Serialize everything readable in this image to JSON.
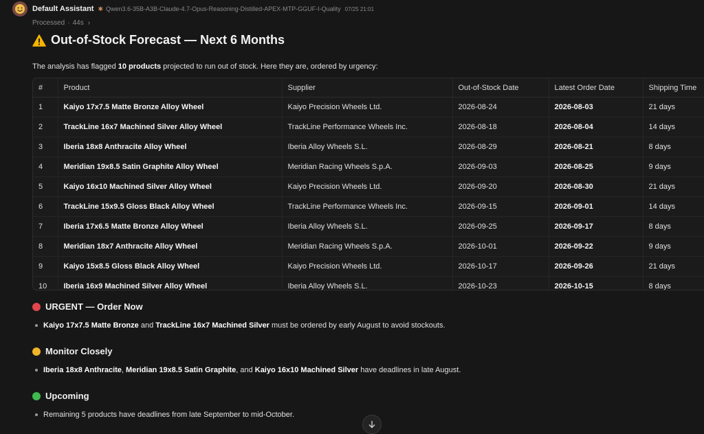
{
  "header": {
    "assistant_name": "Default Assistant",
    "model_name": "Qwen3.6-35B-A3B-Claude-4.7-Opus-Reasoning-Distilled-APEX-MTP-GGUF-I-Quality",
    "timestamp": "07/25 21:01",
    "avatar_icon": "smiley-avatar-icon"
  },
  "status": {
    "processed_label": "Processed",
    "duration": "44s"
  },
  "title": {
    "icon": "warning-icon",
    "text": "Out-of-Stock Forecast — Next 6 Months"
  },
  "intro": {
    "before": "The analysis has flagged ",
    "bold": "10 products",
    "after": " projected to run out of stock. Here they are, ordered by urgency:"
  },
  "table": {
    "headers": [
      "#",
      "Product",
      "Supplier",
      "Out-of-Stock Date",
      "Latest Order Date",
      "Shipping Time"
    ],
    "rows": [
      [
        "1",
        "Kaiyo 17x7.5 Matte Bronze Alloy Wheel",
        "Kaiyo Precision Wheels Ltd.",
        "2026-08-24",
        "2026-08-03",
        "21 days"
      ],
      [
        "2",
        "TrackLine 16x7 Machined Silver Alloy Wheel",
        "TrackLine Performance Wheels Inc.",
        "2026-08-18",
        "2026-08-04",
        "14 days"
      ],
      [
        "3",
        "Iberia 18x8 Anthracite Alloy Wheel",
        "Iberia Alloy Wheels S.L.",
        "2026-08-29",
        "2026-08-21",
        "8 days"
      ],
      [
        "4",
        "Meridian 19x8.5 Satin Graphite Alloy Wheel",
        "Meridian Racing Wheels S.p.A.",
        "2026-09-03",
        "2026-08-25",
        "9 days"
      ],
      [
        "5",
        "Kaiyo 16x10 Machined Silver Alloy Wheel",
        "Kaiyo Precision Wheels Ltd.",
        "2026-09-20",
        "2026-08-30",
        "21 days"
      ],
      [
        "6",
        "TrackLine 15x9.5 Gloss Black Alloy Wheel",
        "TrackLine Performance Wheels Inc.",
        "2026-09-15",
        "2026-09-01",
        "14 days"
      ],
      [
        "7",
        "Iberia 17x6.5 Matte Bronze Alloy Wheel",
        "Iberia Alloy Wheels S.L.",
        "2026-09-25",
        "2026-09-17",
        "8 days"
      ],
      [
        "8",
        "Meridian 18x7 Anthracite Alloy Wheel",
        "Meridian Racing Wheels S.p.A.",
        "2026-10-01",
        "2026-09-22",
        "9 days"
      ],
      [
        "9",
        "Kaiyo 15x8.5 Gloss Black Alloy Wheel",
        "Kaiyo Precision Wheels Ltd.",
        "2026-10-17",
        "2026-09-26",
        "21 days"
      ],
      [
        "10",
        "Iberia 16x9 Machined Silver Alloy Wheel",
        "Iberia Alloy Wheels S.L.",
        "2026-10-23",
        "2026-10-15",
        "8 days"
      ]
    ]
  },
  "sections": {
    "urgent": {
      "color": "#e0474c",
      "heading": "URGENT — Order Now",
      "b1": "Kaiyo 17x7.5 Matte Bronze",
      "t1": " and ",
      "b2": "TrackLine 16x7 Machined Silver",
      "t2": " must be ordered by early August to avoid stockouts."
    },
    "monitor": {
      "color": "#f0b429",
      "heading": "Monitor Closely",
      "b1": "Iberia 18x8 Anthracite",
      "t1": ", ",
      "b2": "Meridian 19x8.5 Satin Graphite",
      "t2": ", and ",
      "b3": "Kaiyo 16x10 Machined Silver",
      "t3": " have deadlines in late August."
    },
    "upcoming": {
      "color": "#3fb950",
      "heading": "Upcoming",
      "text": "Remaining 5 products have deadlines from late September to mid-October."
    }
  },
  "scroll_button_icon": "arrow-down-icon"
}
